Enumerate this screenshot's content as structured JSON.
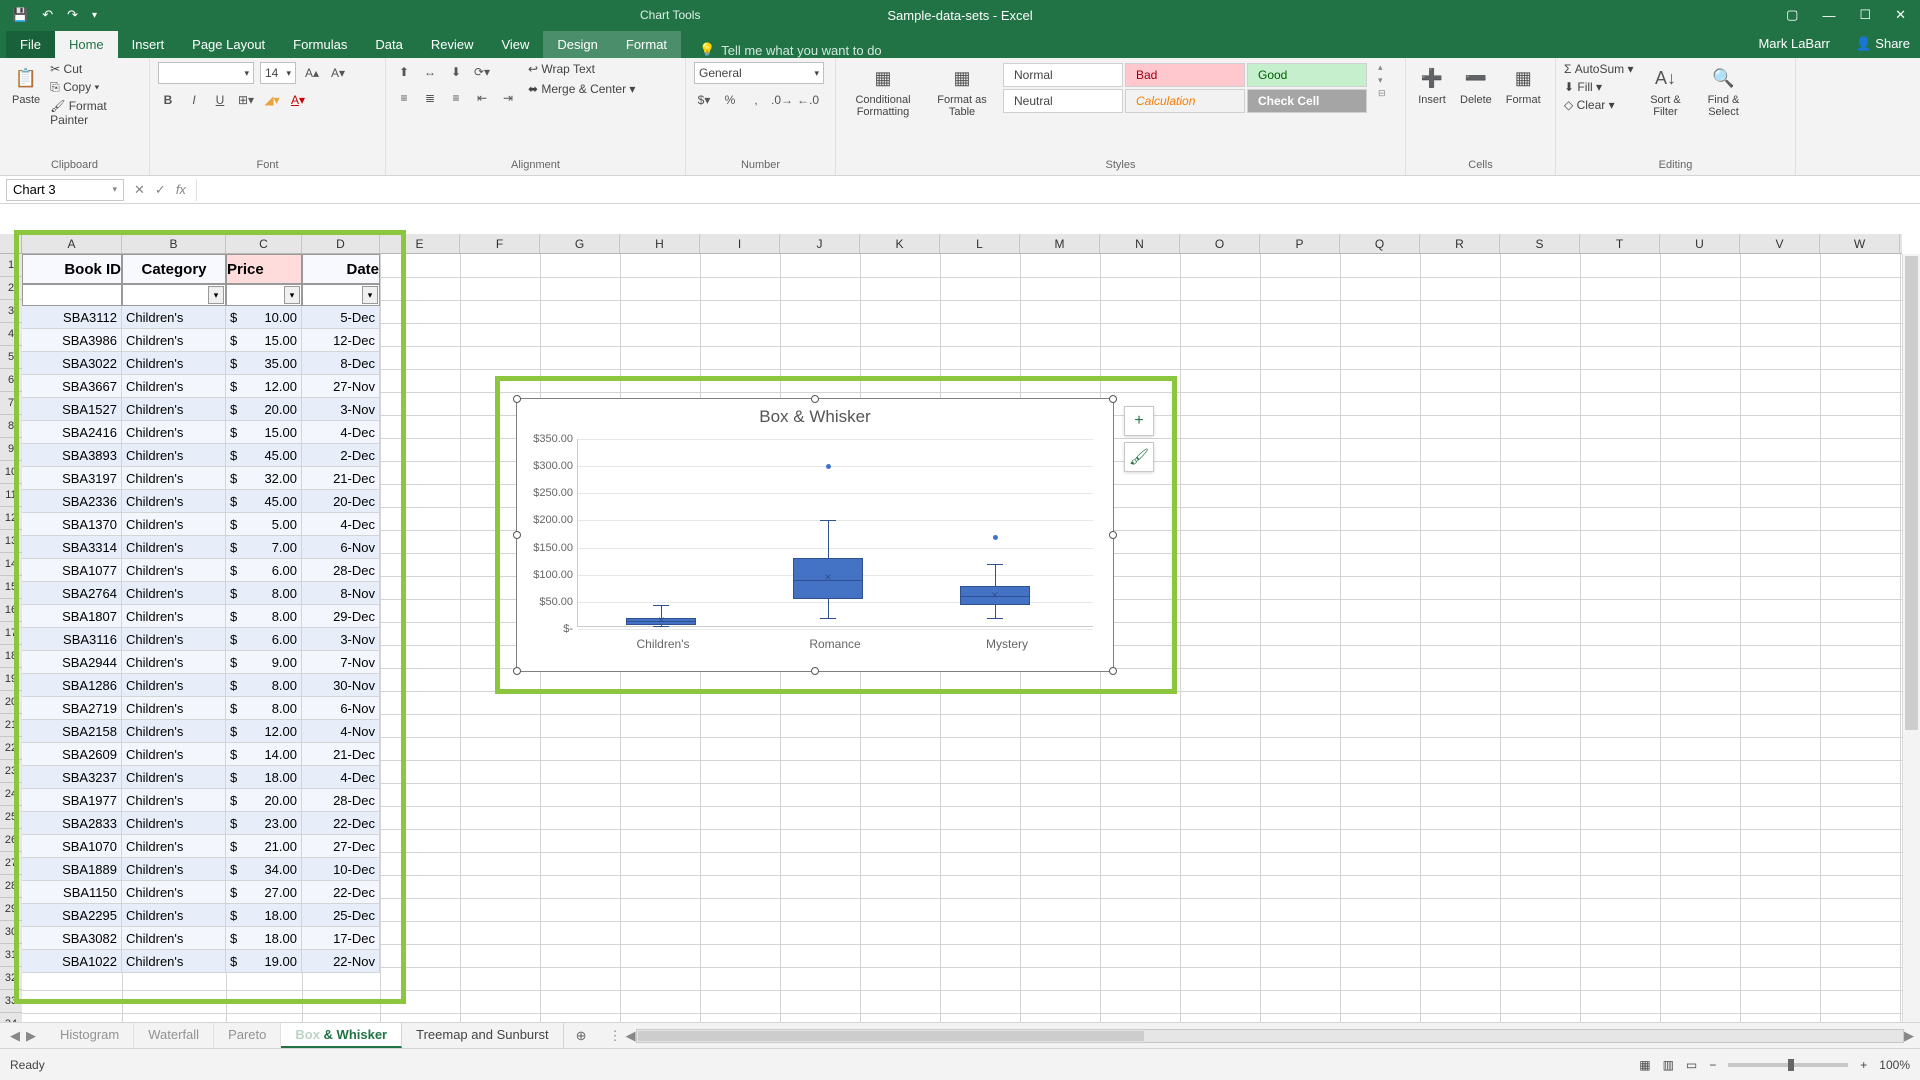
{
  "titlebar": {
    "doc": "Sample-data-sets - Excel",
    "chart_tools": "Chart Tools"
  },
  "tabs": {
    "file": "File",
    "home": "Home",
    "insert": "Insert",
    "page_layout": "Page Layout",
    "formulas": "Formulas",
    "data": "Data",
    "review": "Review",
    "view": "View",
    "design": "Design",
    "format": "Format"
  },
  "tellme": "Tell me what you want to do",
  "user": "Mark LaBarr",
  "share": "Share",
  "ribbon": {
    "clipboard": {
      "paste": "Paste",
      "cut": "Cut",
      "copy": "Copy",
      "painter": "Format Painter",
      "label": "Clipboard"
    },
    "font": {
      "size": "14",
      "label": "Font"
    },
    "alignment": {
      "wrap": "Wrap Text",
      "merge": "Merge & Center",
      "label": "Alignment"
    },
    "number": {
      "general": "General",
      "label": "Number"
    },
    "styles": {
      "cond": "Conditional Formatting",
      "fmt_table": "Format as Table",
      "normal": "Normal",
      "bad": "Bad",
      "good": "Good",
      "neutral": "Neutral",
      "calc": "Calculation",
      "check": "Check Cell",
      "label": "Styles"
    },
    "cells": {
      "insert": "Insert",
      "delete": "Delete",
      "format": "Format",
      "label": "Cells"
    },
    "editing": {
      "autosum": "AutoSum",
      "fill": "Fill",
      "clear": "Clear",
      "sort": "Sort & Filter",
      "find": "Find & Select",
      "label": "Editing"
    }
  },
  "name_box": "Chart 3",
  "columns": [
    "A",
    "B",
    "C",
    "D",
    "E",
    "F",
    "G",
    "H",
    "I",
    "J",
    "K",
    "L",
    "M",
    "N",
    "O",
    "P",
    "Q",
    "R",
    "S",
    "T",
    "U",
    "V",
    "W"
  ],
  "headers": {
    "book_id": "Book ID",
    "category": "Category",
    "price": "Price",
    "date": "Date"
  },
  "rows": [
    {
      "id": "SBA3112",
      "cat": "Children's",
      "price": "10.00",
      "date": "5-Dec"
    },
    {
      "id": "SBA3986",
      "cat": "Children's",
      "price": "15.00",
      "date": "12-Dec"
    },
    {
      "id": "SBA3022",
      "cat": "Children's",
      "price": "35.00",
      "date": "8-Dec"
    },
    {
      "id": "SBA3667",
      "cat": "Children's",
      "price": "12.00",
      "date": "27-Nov"
    },
    {
      "id": "SBA1527",
      "cat": "Children's",
      "price": "20.00",
      "date": "3-Nov"
    },
    {
      "id": "SBA2416",
      "cat": "Children's",
      "price": "15.00",
      "date": "4-Dec"
    },
    {
      "id": "SBA3893",
      "cat": "Children's",
      "price": "45.00",
      "date": "2-Dec"
    },
    {
      "id": "SBA3197",
      "cat": "Children's",
      "price": "32.00",
      "date": "21-Dec"
    },
    {
      "id": "SBA2336",
      "cat": "Children's",
      "price": "45.00",
      "date": "20-Dec"
    },
    {
      "id": "SBA1370",
      "cat": "Children's",
      "price": "5.00",
      "date": "4-Dec"
    },
    {
      "id": "SBA3314",
      "cat": "Children's",
      "price": "7.00",
      "date": "6-Nov"
    },
    {
      "id": "SBA1077",
      "cat": "Children's",
      "price": "6.00",
      "date": "28-Dec"
    },
    {
      "id": "SBA2764",
      "cat": "Children's",
      "price": "8.00",
      "date": "8-Nov"
    },
    {
      "id": "SBA1807",
      "cat": "Children's",
      "price": "8.00",
      "date": "29-Dec"
    },
    {
      "id": "SBA3116",
      "cat": "Children's",
      "price": "6.00",
      "date": "3-Nov"
    },
    {
      "id": "SBA2944",
      "cat": "Children's",
      "price": "9.00",
      "date": "7-Nov"
    },
    {
      "id": "SBA1286",
      "cat": "Children's",
      "price": "8.00",
      "date": "30-Nov"
    },
    {
      "id": "SBA2719",
      "cat": "Children's",
      "price": "8.00",
      "date": "6-Nov"
    },
    {
      "id": "SBA2158",
      "cat": "Children's",
      "price": "12.00",
      "date": "4-Nov"
    },
    {
      "id": "SBA2609",
      "cat": "Children's",
      "price": "14.00",
      "date": "21-Dec"
    },
    {
      "id": "SBA3237",
      "cat": "Children's",
      "price": "18.00",
      "date": "4-Dec"
    },
    {
      "id": "SBA1977",
      "cat": "Children's",
      "price": "20.00",
      "date": "28-Dec"
    },
    {
      "id": "SBA2833",
      "cat": "Children's",
      "price": "23.00",
      "date": "22-Dec"
    },
    {
      "id": "SBA1070",
      "cat": "Children's",
      "price": "21.00",
      "date": "27-Dec"
    },
    {
      "id": "SBA1889",
      "cat": "Children's",
      "price": "34.00",
      "date": "10-Dec"
    },
    {
      "id": "SBA1150",
      "cat": "Children's",
      "price": "27.00",
      "date": "22-Dec"
    },
    {
      "id": "SBA2295",
      "cat": "Children's",
      "price": "18.00",
      "date": "25-Dec"
    },
    {
      "id": "SBA3082",
      "cat": "Children's",
      "price": "18.00",
      "date": "17-Dec"
    },
    {
      "id": "SBA1022",
      "cat": "Children's",
      "price": "19.00",
      "date": "22-Nov"
    }
  ],
  "currency": "$",
  "chart_data": {
    "type": "box",
    "title": "Box & Whisker",
    "ylim": [
      0,
      350
    ],
    "yticks": [
      "$-",
      "$50.00",
      "$100.00",
      "$150.00",
      "$200.00",
      "$250.00",
      "$300.00",
      "$350.00"
    ],
    "categories": [
      "Children's",
      "Romance",
      "Mystery"
    ],
    "series": [
      {
        "name": "Children's",
        "min": 5,
        "q1": 8,
        "median": 15,
        "q3": 21,
        "max": 45,
        "mean": 17,
        "outliers": []
      },
      {
        "name": "Romance",
        "min": 20,
        "q1": 55,
        "median": 90,
        "q3": 130,
        "max": 200,
        "mean": 95,
        "outliers": [
          300
        ]
      },
      {
        "name": "Mystery",
        "min": 20,
        "q1": 45,
        "median": 60,
        "q3": 80,
        "max": 120,
        "mean": 62,
        "outliers": [
          170
        ]
      }
    ]
  },
  "sheet_tabs": {
    "prev1": "Histogram",
    "prev2": "Waterfall",
    "prev3": "Pareto",
    "active_partial": " & Whisker",
    "next": "Treemap and Sunburst"
  },
  "status": {
    "ready": "Ready",
    "zoom": "100%"
  }
}
